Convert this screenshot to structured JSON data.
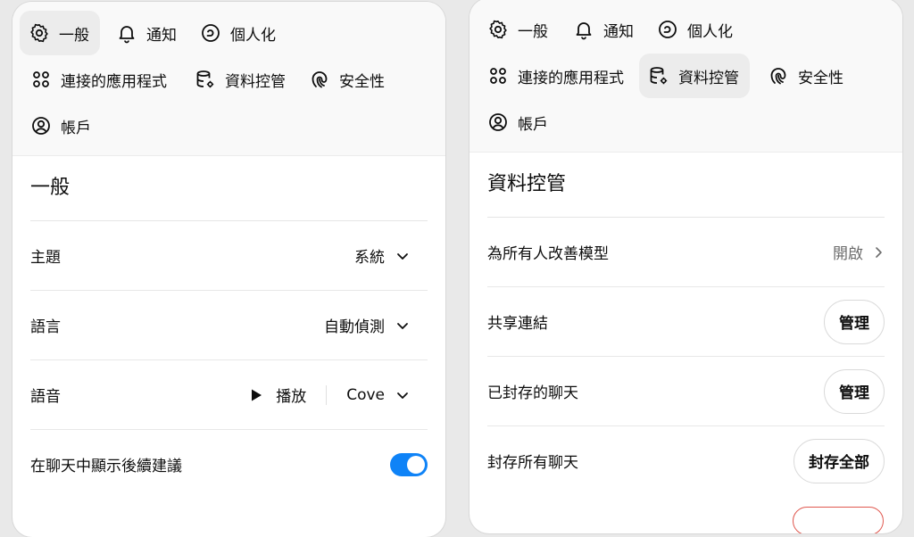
{
  "left_panel": {
    "tabs": [
      {
        "label": "一般",
        "icon": "gear-icon"
      },
      {
        "label": "通知",
        "icon": "bell-icon"
      },
      {
        "label": "個人化",
        "icon": "personalize-icon"
      },
      {
        "label": "連接的應用程式",
        "icon": "apps-icon"
      },
      {
        "label": "資料控管",
        "icon": "database-icon"
      },
      {
        "label": "安全性",
        "icon": "fingerprint-icon"
      },
      {
        "label": "帳戶",
        "icon": "account-icon"
      }
    ],
    "active_tab": "一般",
    "section_title": "一般",
    "settings": {
      "theme_label": "主題",
      "theme_value": "系統",
      "language_label": "語言",
      "language_value": "自動偵測",
      "voice_label": "語音",
      "voice_play": "播放",
      "voice_value": "Cove",
      "followup_label": "在聊天中顯示後續建議",
      "followup_enabled": true
    }
  },
  "right_panel": {
    "tabs": [
      {
        "label": "一般",
        "icon": "gear-icon"
      },
      {
        "label": "通知",
        "icon": "bell-icon"
      },
      {
        "label": "個人化",
        "icon": "personalize-icon"
      },
      {
        "label": "連接的應用程式",
        "icon": "apps-icon"
      },
      {
        "label": "資料控管",
        "icon": "database-icon"
      },
      {
        "label": "安全性",
        "icon": "fingerprint-icon"
      },
      {
        "label": "帳戶",
        "icon": "account-icon"
      }
    ],
    "active_tab": "資料控管",
    "section_title": "資料控管",
    "settings": {
      "improve_label": "為所有人改善模型",
      "improve_value": "開啟",
      "share_label": "共享連結",
      "share_button": "管理",
      "archived_label": "已封存的聊天",
      "archived_button": "管理",
      "archive_all_label": "封存所有聊天",
      "archive_all_button": "封存全部"
    }
  },
  "colors": {
    "toggle_on": "#0f83f7",
    "tab_active_bg": "#ececec",
    "danger_border": "#e0584f"
  }
}
